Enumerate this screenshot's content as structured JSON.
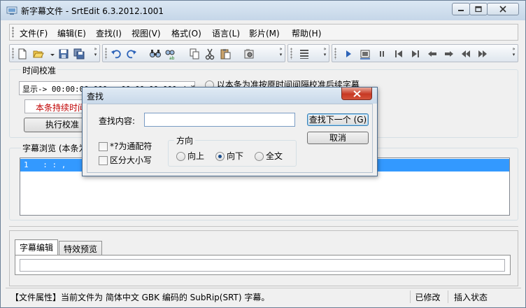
{
  "window": {
    "title": "新字幕文件 - SrtEdit 6.3.2012.1001"
  },
  "menu": [
    {
      "label": "文件(F)"
    },
    {
      "label": "编辑(E)"
    },
    {
      "label": "查找(I)"
    },
    {
      "label": "视图(V)"
    },
    {
      "label": "格式(O)"
    },
    {
      "label": "语言(L)"
    },
    {
      "label": "影片(M)"
    },
    {
      "label": "帮助(H)"
    }
  ],
  "toolbar_icons": {
    "group1": [
      "new-file-icon",
      "open-folder-icon",
      "save-icon",
      "save-all-icon"
    ],
    "group2": [
      "undo-icon",
      "redo-icon",
      "find-icon",
      "replace-icon",
      "copy-icon",
      "cut-icon",
      "paste-icon",
      "properties-icon"
    ],
    "group3": [
      "list-icon"
    ],
    "group4": [
      "play-icon",
      "screenshot-icon",
      "pause-icon",
      "first-icon",
      "last-icon",
      "prev-icon",
      "next-icon",
      "rewind-icon",
      "forward-icon"
    ]
  },
  "time_calibration": {
    "group_label": "时间校准",
    "display_prefix": "显示->",
    "display_value": "00:00:00,000 - 00:00:00,000  / 激略",
    "option_behind": "以本条为准按原时间间隔校准后续字幕",
    "duration_label": "本条持续时间",
    "execute_button": "执行校准"
  },
  "browse": {
    "group_label": "字幕浏览 (本条为",
    "rows": [
      {
        "index": "1",
        "time": "  :  :  ,"
      }
    ]
  },
  "tabs": [
    {
      "label": "字幕编辑",
      "active": true
    },
    {
      "label": "特效预览",
      "active": false
    }
  ],
  "status": {
    "file_info": "【文件属性】当前文件为 简体中文 GBK 编码的 SubRip(SRT) 字幕。",
    "modified": "已修改",
    "mode": "插入状态"
  },
  "find_dialog": {
    "title": "查找",
    "content_label": "查找内容:",
    "content_value": "",
    "find_next_button": "查找下一个 (G)",
    "cancel_button": "取消",
    "wildcard_label": "*?为通配符",
    "wildcard_checked": false,
    "case_label": "区分大小写",
    "case_checked": false,
    "direction_label": "方向",
    "direction_options": [
      {
        "label": "向上",
        "selected": false
      },
      {
        "label": "向下",
        "selected": true
      },
      {
        "label": "全文",
        "selected": false
      }
    ]
  }
}
